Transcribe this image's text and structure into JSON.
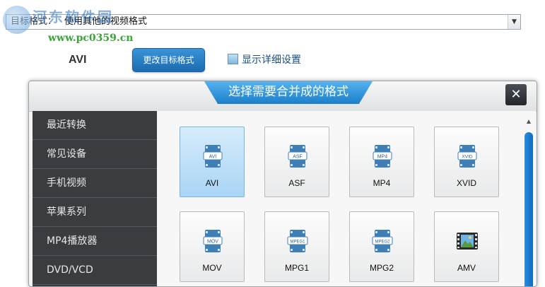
{
  "watermark": {
    "title": "河东软件园",
    "url": "www.pc0359.cn"
  },
  "format_bar": {
    "label": "目标格式：",
    "value": "使用其他的视频格式"
  },
  "current_format": "AVI",
  "change_format_button": "更改目标格式",
  "show_details_label": "显示详细设置",
  "dialog": {
    "title": "选择需要合并成的格式",
    "close_glyph": "✕",
    "sidebar_items": [
      "最近转换",
      "常见设备",
      "手机视频",
      "苹果系列",
      "MP4播放器",
      "DVD/VCD"
    ],
    "formats": [
      {
        "name": "AVI",
        "badge": "AVI",
        "selected": true
      },
      {
        "name": "ASF",
        "badge": "ASF",
        "selected": false
      },
      {
        "name": "MP4",
        "badge": "MP4",
        "selected": false
      },
      {
        "name": "XVID",
        "badge": "XVID",
        "selected": false
      },
      {
        "name": "MOV",
        "badge": "MOV",
        "selected": false
      },
      {
        "name": "MPG1",
        "badge": "MPEG1",
        "selected": false
      },
      {
        "name": "MPG2",
        "badge": "MPEG2",
        "selected": false
      },
      {
        "name": "AMV",
        "badge": "",
        "selected": false
      }
    ]
  },
  "colors": {
    "accent": "#1b7fc9",
    "sidebar": "#3a3d40",
    "selected_tile": "#a9d5f5"
  },
  "icons": {
    "film": "film-strip-icon",
    "close": "close-icon",
    "dropdown": "chevron-down-icon"
  }
}
